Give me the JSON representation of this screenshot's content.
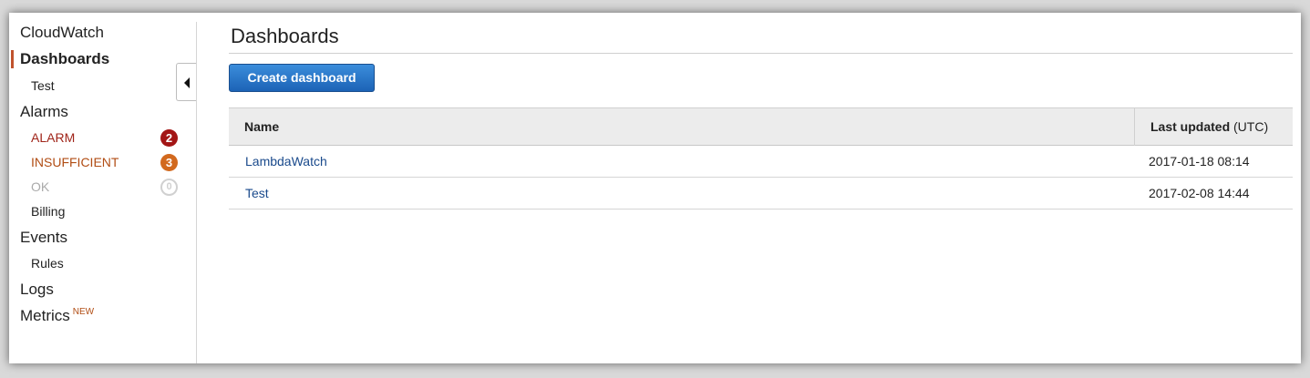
{
  "sidebar": {
    "service_title": "CloudWatch",
    "dashboards": "Dashboards",
    "dashboards_sub": "Test",
    "alarms": "Alarms",
    "alarm_states": [
      {
        "label": "ALARM",
        "count": "2",
        "color": "#a31515"
      },
      {
        "label": "INSUFFICIENT",
        "count": "3",
        "color": "#d2691e"
      },
      {
        "label": "OK",
        "count": "0",
        "color": "#d0d0d0"
      }
    ],
    "billing": "Billing",
    "events": "Events",
    "rules": "Rules",
    "logs": "Logs",
    "metrics": "Metrics",
    "metrics_badge": "NEW",
    "collapse_icon": "caret-left-icon"
  },
  "main": {
    "title": "Dashboards",
    "create_button": "Create dashboard",
    "table": {
      "col_name": "Name",
      "col_updated": "Last updated",
      "col_updated_suffix": " (UTC)",
      "rows": [
        {
          "name": "LambdaWatch",
          "updated": "2017-01-18 08:14"
        },
        {
          "name": "Test",
          "updated": "2017-02-08 14:44"
        }
      ]
    }
  },
  "colors": {
    "active_indicator": "#c0532d",
    "primary_button": "#1c63b6",
    "link": "#1a4a8c"
  }
}
